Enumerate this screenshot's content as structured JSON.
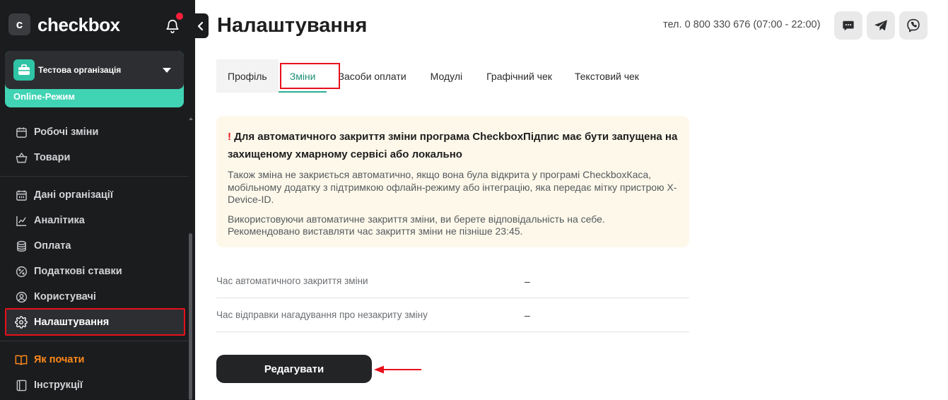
{
  "brand": {
    "name": "checkbox",
    "mark": "c"
  },
  "sidebar": {
    "org_name": "Тестова організація",
    "org_mode": "Online-Режим",
    "items": [
      {
        "label": "Робочі зміни",
        "icon": "calendar-icon"
      },
      {
        "label": "Товари",
        "icon": "basket-icon"
      },
      {
        "label": "Дані організації",
        "icon": "building-icon"
      },
      {
        "label": "Аналітика",
        "icon": "chart-icon"
      },
      {
        "label": "Оплата",
        "icon": "coins-icon"
      },
      {
        "label": "Податкові ставки",
        "icon": "percent-icon"
      },
      {
        "label": "Користувачі",
        "icon": "user-icon"
      },
      {
        "label": "Налаштування",
        "icon": "gear-icon"
      },
      {
        "label": "Як почати",
        "icon": "book-icon"
      },
      {
        "label": "Інструкції",
        "icon": "document-icon"
      }
    ]
  },
  "header": {
    "title": "Налаштування",
    "phone": "тел. 0 800 330 676 (07:00 - 22:00)"
  },
  "tabs": [
    "Профіль",
    "Зміни",
    "Засоби оплати",
    "Модулі",
    "Графічний чек",
    "Текстовий чек"
  ],
  "notice": {
    "mark": "!",
    "title": "Для автоматичного закриття зміни програма CheckboxПідпис має бути запущена на захищеному хмарному сервісі або локально",
    "p1": "Також зміна не закриється автоматично, якщо вона була відкрита у програмі CheckboxКаса, мобільному додатку з підтримкою офлайн-режиму або інтеграцію, яка передає мітку пристрою X-Device-ID.",
    "p2": "Використовуючи автоматичне закриття зміни, ви берете відповідальність на себе. Рекомендовано виставляти час закриття зміни не пізніше 23:45."
  },
  "settings": [
    {
      "label": "Час автоматичного закриття зміни",
      "value": "–"
    },
    {
      "label": "Час відправки нагадування про незакриту зміну",
      "value": "–"
    }
  ],
  "edit_button": "Редагувати",
  "colors": {
    "sidebar_bg": "#1b1c1e",
    "accent_green": "#40d3b4",
    "highlight_red": "#e8101c",
    "notice_bg": "#fdf8ea",
    "orange": "#ff8a1a"
  }
}
